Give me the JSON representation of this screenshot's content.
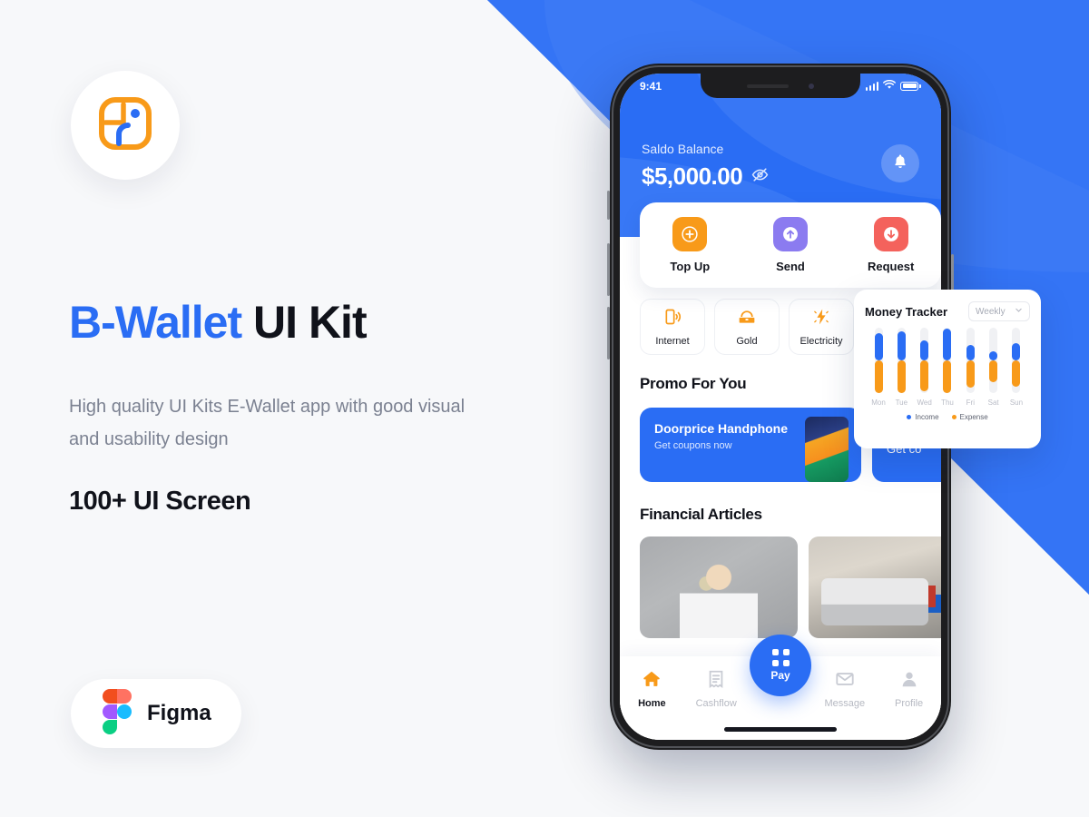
{
  "brand": {
    "logo_icon": "b-wallet-logo-icon",
    "accent_blue": "#2a6df4",
    "accent_orange": "#f89a19",
    "accent_purple": "#8b7bf0",
    "accent_red": "#f4625c"
  },
  "hero": {
    "title_highlight": "B-Wallet",
    "title_rest": " UI Kit",
    "subtitle": "High quality UI Kits E-Wallet app with good visual  and usability design",
    "screens": "100+ UI Screen"
  },
  "figma": {
    "label": "Figma",
    "icon": "figma-logo-icon"
  },
  "phone": {
    "status": {
      "time": "9:41",
      "signal_icon": "cellular-bars-icon",
      "wifi_icon": "wifi-icon",
      "battery_icon": "battery-icon"
    },
    "header": {
      "balance_label": "Saldo Balance",
      "balance_amount": "$5,000.00",
      "hide_icon": "eye-off-icon",
      "bell_icon": "bell-icon"
    },
    "quick_actions": [
      {
        "label": "Top Up",
        "icon": "plus-circle-icon",
        "color": "#f89a19"
      },
      {
        "label": "Send",
        "icon": "arrow-up-circle-icon",
        "color": "#8b7bf0"
      },
      {
        "label": "Request",
        "icon": "arrow-down-circle-icon",
        "color": "#f4625c"
      }
    ],
    "services": [
      {
        "label": "Internet",
        "icon": "mobile-signal-icon"
      },
      {
        "label": "Gold",
        "icon": "gold-bar-icon"
      },
      {
        "label": "Electricity",
        "icon": "lightning-bolt-icon"
      }
    ],
    "promo": {
      "section_title": "Promo For You",
      "cards": [
        {
          "title": "Doorprice Handphone",
          "subtitle": "Get coupons now"
        },
        {
          "title": "",
          "subtitle": "Get co"
        }
      ]
    },
    "articles": {
      "section_title": "Financial Articles"
    },
    "bottom_nav": {
      "items": [
        {
          "label": "Home",
          "icon": "home-icon",
          "active": true
        },
        {
          "label": "Cashflow",
          "icon": "receipt-icon",
          "active": false
        },
        {
          "label": "Message",
          "icon": "envelope-icon",
          "active": false
        },
        {
          "label": "Profile",
          "icon": "person-icon",
          "active": false
        }
      ],
      "pay": {
        "label": "Pay",
        "icon": "qr-scan-icon"
      }
    }
  },
  "tracker": {
    "title": "Money Tracker",
    "period": "Weekly",
    "chevron_icon": "chevron-down-icon",
    "legend": [
      {
        "label": "Income",
        "color": "#2a6df4"
      },
      {
        "label": "Expense",
        "color": "#f89a19"
      }
    ]
  },
  "chart_data": {
    "type": "bar",
    "title": "Money Tracker",
    "categories": [
      "Mon",
      "Tue",
      "Wed",
      "Thu",
      "Fri",
      "Sat",
      "Sun"
    ],
    "series": [
      {
        "name": "Income",
        "color": "#2a6df4",
        "values": [
          42,
          45,
          30,
          48,
          24,
          14,
          26
        ]
      },
      {
        "name": "Expense",
        "color": "#f89a19",
        "values": [
          55,
          56,
          47,
          54,
          42,
          33,
          40
        ]
      }
    ],
    "ylim": [
      0,
      100
    ],
    "grid": false,
    "legend_position": "bottom",
    "xlabel": "",
    "ylabel": ""
  }
}
